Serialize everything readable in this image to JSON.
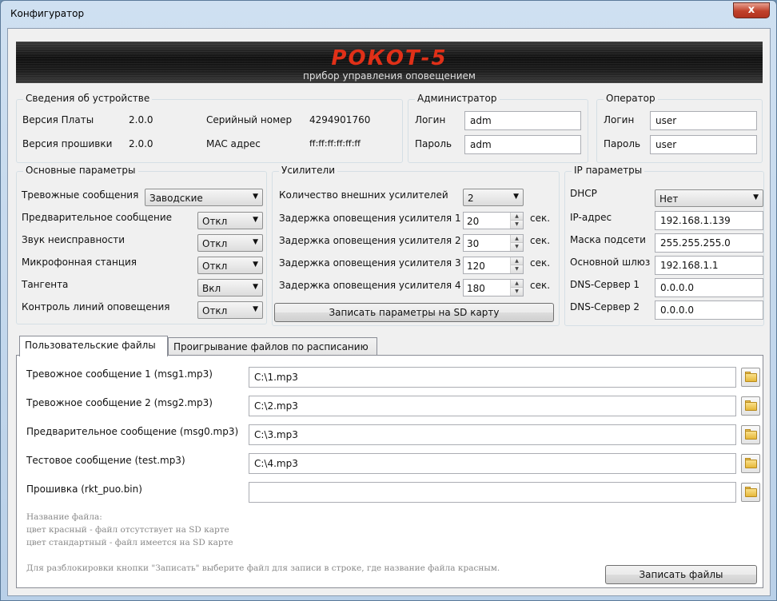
{
  "window": {
    "title": "Конфигуратор",
    "close_label": "x"
  },
  "banner": {
    "brand": "РОКОТ-5",
    "subtitle": "прибор управления оповещением"
  },
  "device": {
    "group_title": "Сведения об устройстве",
    "board_label": "Версия Платы",
    "board_value": "2.0.0",
    "firmware_label": "Версия прошивки",
    "firmware_value": "2.0.0",
    "serial_label": "Серийный номер",
    "serial_value": "4294901760",
    "mac_label": "MAC адрес",
    "mac_value": "ff:ff:ff:ff:ff:ff"
  },
  "admin": {
    "group_title": "Администратор",
    "login_label": "Логин",
    "login_value": "adm",
    "password_label": "Пароль",
    "password_value": "adm"
  },
  "operator": {
    "group_title": "Оператор",
    "login_label": "Логин",
    "login_value": "user",
    "password_label": "Пароль",
    "password_value": "user"
  },
  "basic": {
    "group_title": "Основные параметры",
    "alarm_label": "Тревожные сообщения",
    "alarm_value": "Заводские",
    "prelim_label": "Предварительное сообщение",
    "prelim_value": "Откл",
    "fault_sound_label": "Звук неисправности",
    "fault_sound_value": "Откл",
    "mic_label": "Микрофонная станция",
    "mic_value": "Откл",
    "ptt_label": "Тангента",
    "ptt_value": "Вкл",
    "line_ctrl_label": "Контроль линий оповещения",
    "line_ctrl_value": "Откл"
  },
  "amps": {
    "group_title": "Усилители",
    "count_label": "Количество внешних усилителей",
    "count_value": "2",
    "delay_unit": "сек.",
    "delays": [
      {
        "label": "Задержка оповещения усилителя 1",
        "value": "20"
      },
      {
        "label": "Задержка оповещения усилителя 2",
        "value": "30"
      },
      {
        "label": "Задержка оповещения усилителя 3",
        "value": "120"
      },
      {
        "label": "Задержка оповещения усилителя 4",
        "value": "180"
      }
    ],
    "write_sd_label": "Записать параметры на SD карту"
  },
  "ip": {
    "group_title": "IP параметры",
    "dhcp_label": "DHCP",
    "dhcp_value": "Нет",
    "ip_label": "IP-адрес",
    "ip_value": "192.168.1.139",
    "mask_label": "Маска подсети",
    "mask_value": "255.255.255.0",
    "gateway_label": "Основной шлюз",
    "gateway_value": "192.168.1.1",
    "dns1_label": "DNS-Сервер 1",
    "dns1_value": "0.0.0.0",
    "dns2_label": "DNS-Сервер 2",
    "dns2_value": "0.0.0.0"
  },
  "tabs": [
    {
      "label": "Пользовательские файлы"
    },
    {
      "label": "Проигрывание файлов по расписанию"
    }
  ],
  "files": [
    {
      "label": "Тревожное сообщение 1 (msg1.mp3)",
      "path": "C:\\1.mp3"
    },
    {
      "label": "Тревожное сообщение 2 (msg2.mp3)",
      "path": "C:\\2.mp3"
    },
    {
      "label": "Предварительное сообщение (msg0.mp3)",
      "path": "C:\\3.mp3"
    },
    {
      "label": "Тестовое сообщение (test.mp3)",
      "path": "C:\\4.mp3"
    },
    {
      "label": "Прошивка (rkt_puo.bin)",
      "path": ""
    }
  ],
  "notes": {
    "line1": "Название файла:",
    "line2": "цвет красный - файл отсутствует на SD карте",
    "line3": "цвет стандартный - файл имеется на SD карте",
    "unlock_hint": "Для разблокировки кнопки \"Записать\" выберите файл для записи в строке, где название файла красным."
  },
  "write_files_label": "Записать файлы",
  "colors": {
    "brand": "#e03018",
    "titlebar": "#cfe0f1",
    "close": "#c0412b"
  }
}
